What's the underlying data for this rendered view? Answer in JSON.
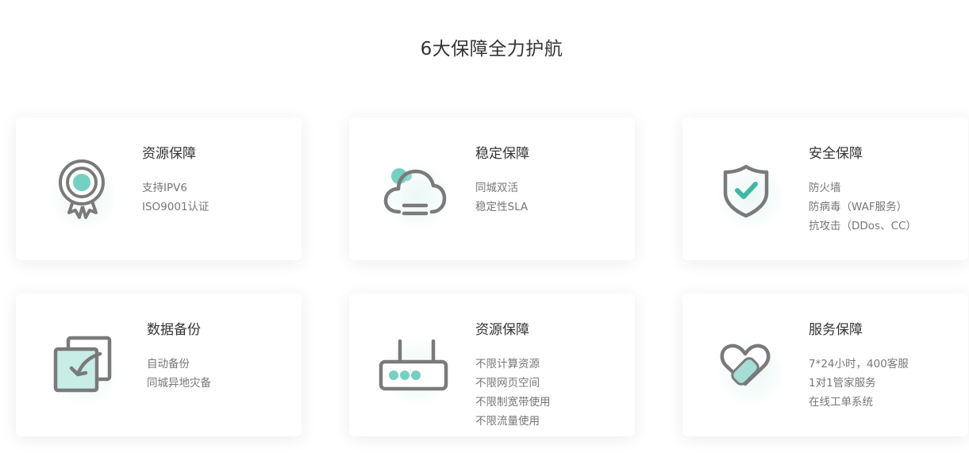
{
  "section": {
    "title": "6大保障全力护航"
  },
  "colors": {
    "accent": "#76cfc3",
    "icon_gray": "#7a7a7a"
  },
  "cards": [
    {
      "title": "资源保障",
      "icon": "award-medal-icon",
      "items": [
        "支持IPV6",
        "ISO9001认证"
      ]
    },
    {
      "title": "稳定保障",
      "icon": "cloud-icon",
      "items": [
        "同城双活",
        "稳定性SLA"
      ]
    },
    {
      "title": "安全保障",
      "icon": "shield-check-icon",
      "items": [
        "防火墙",
        "防病毒（WAF服务）",
        "抗攻击（DDos、CC）"
      ]
    },
    {
      "title": "数据备份",
      "icon": "backup-copy-icon",
      "items": [
        "自动备份",
        "同城异地灾备"
      ]
    },
    {
      "title": "资源保障",
      "icon": "router-icon",
      "items": [
        "不限计算资源",
        "不限网页空间",
        "不限制宽带使用",
        "不限流量使用"
      ]
    },
    {
      "title": "服务保障",
      "icon": "heart-bandage-icon",
      "items": [
        "7*24小时，400客服",
        "1对1管家服务",
        "在线工单系统"
      ]
    }
  ]
}
